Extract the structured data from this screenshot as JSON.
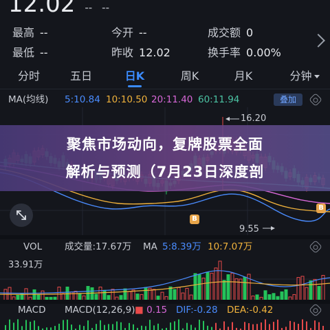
{
  "quote": {
    "price": "12.02",
    "change": "--",
    "change_pct": "--"
  },
  "stats": {
    "high_label": "最高",
    "high_value": "--",
    "open_label": "今开",
    "open_value": "--",
    "volume_label": "成交额",
    "volume_value": "0",
    "low_label": "最低",
    "low_value": "--",
    "prev_close_label": "昨收",
    "prev_close_value": "12.02",
    "turnover_label": "换手率",
    "turnover_value": "0.00%"
  },
  "tabs": [
    "分时",
    "五日",
    "日K",
    "周K",
    "月K",
    "分钟"
  ],
  "active_tab": "日K",
  "ma": {
    "label": "MA(均线)",
    "ma5": "5:10.84",
    "ma10": "10:10.50",
    "ma20": "20:11.40",
    "ma60": "60:11.94",
    "overlay_label": "叠加",
    "colors": {
      "ma5": "#4a8cff",
      "ma10": "#f0b23c",
      "ma20": "#d868d8",
      "ma60": "#4cc4a4"
    }
  },
  "kline": {
    "high_marker": "16.20",
    "low_marker": "9.55",
    "badge": "B",
    "up_color": "#e84a4a",
    "down_color": "#25c25a"
  },
  "banner": {
    "line1": "聚焦市场动向，复牌股票全面",
    "line2": "解析与预测（7月23日深度剖"
  },
  "volume": {
    "label": "VOL",
    "total": "成交量:17.67万",
    "ma_label": "MA",
    "ma5": "5:8.39万",
    "ma10": "10:7.07万",
    "axis_max": "33.91万"
  },
  "macd": {
    "label": "MACD",
    "params": "MACD(12,26,9)",
    "value": "0.15",
    "dif": "DIF:-0.28",
    "dea": "DEA:-0.42"
  }
}
